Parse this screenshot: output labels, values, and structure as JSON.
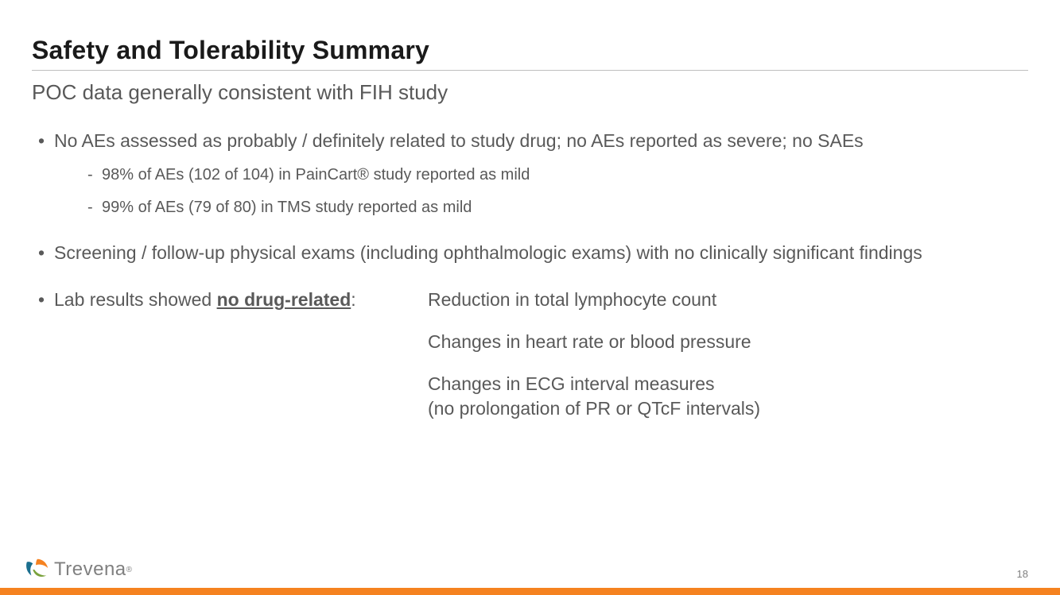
{
  "title": "Safety and Tolerability Summary",
  "subtitle": "POC data generally consistent with FIH study",
  "bullet1": "No AEs assessed as probably / definitely related to study drug; no AEs reported as severe; no SAEs",
  "sub1a": "98% of AEs (102 of 104) in PainCart® study reported as mild",
  "sub1b": "99% of AEs (79 of 80) in TMS study reported as mild",
  "bullet2": "Screening / follow-up physical exams (including ophthalmologic exams) with no clinically significant findings",
  "bullet3_prefix": "Lab results showed ",
  "bullet3_emph": "no drug-related",
  "bullet3_suffix": ":",
  "lab_items": {
    "a": "Reduction in total lymphocyte count",
    "b": "Changes in heart rate or blood pressure",
    "c_line1": "Changes in ECG interval measures",
    "c_line2": "(no prolongation of PR or QTcF intervals)"
  },
  "brand": "Trevena",
  "page": "18"
}
